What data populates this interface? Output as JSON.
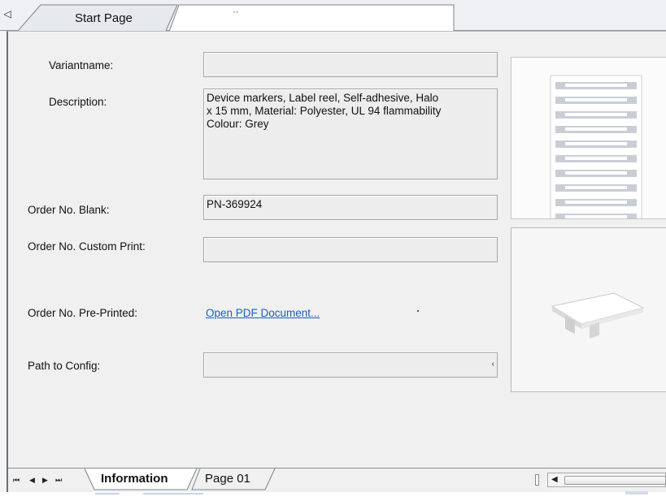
{
  "tabs": {
    "start_page": "Start Page",
    "active_tab_title": "··"
  },
  "form": {
    "variantname_label": "Variantname:",
    "variantname_value": "",
    "description_label": "Description:",
    "description_value": "Device markers, Label reel, Self-adhesive, Halo\nx 15 mm, Material: Polyester, UL 94 flammability\nColour: Grey",
    "order_blank_label": "Order No. Blank:",
    "order_blank_value": "PN-369924",
    "order_custom_label": "Order No. Custom Print:",
    "order_custom_value": "",
    "order_preprinted_label": "Order No. Pre-Printed:",
    "open_pdf_link": "Open PDF Document...",
    "path_config_label": "Path to Config:",
    "path_config_value": ""
  },
  "sheets": {
    "information": "Information",
    "page01": "Page 01"
  },
  "icons": {
    "tab_scroll_left": "left-triangle-icon",
    "nav_first": "first-page-icon",
    "nav_prev": "prev-page-icon",
    "nav_next": "next-page-icon",
    "nav_last": "last-page-icon"
  },
  "colors": {
    "link": "#1560c8",
    "field_bg": "#ededed"
  }
}
